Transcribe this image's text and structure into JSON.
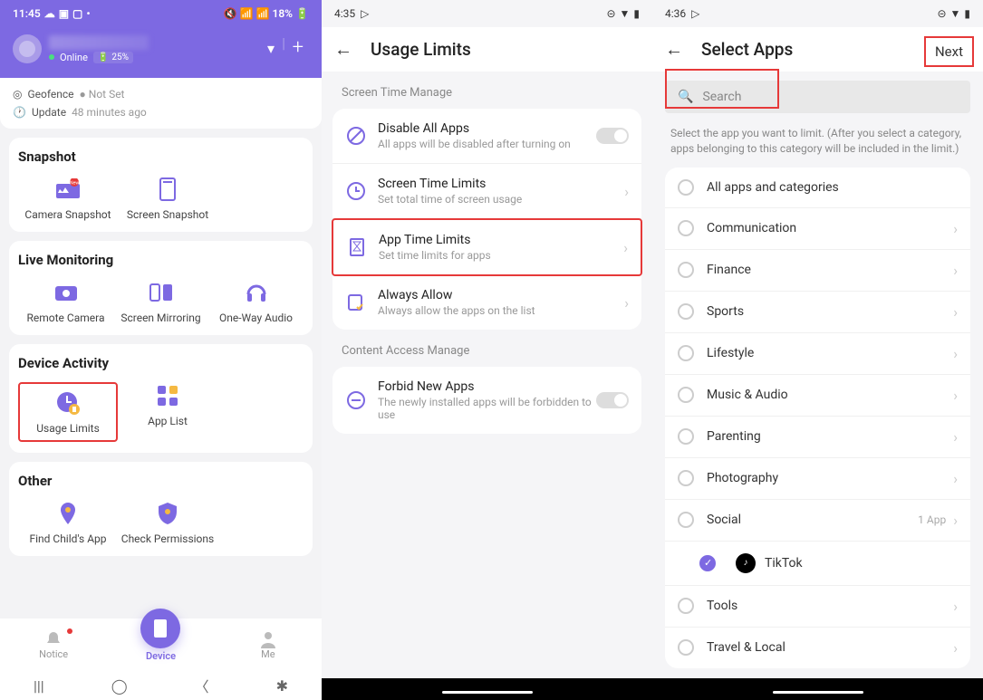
{
  "screen1": {
    "status": {
      "time": "11:45",
      "battery": "18%"
    },
    "profile": {
      "status": "Online",
      "battery": "25%"
    },
    "info": {
      "geofence_label": "Geofence",
      "geofence_value": "Not Set",
      "update_label": "Update",
      "update_value": "48 minutes ago"
    },
    "sections": {
      "snapshot": {
        "title": "Snapshot",
        "camera": "Camera Snapshot",
        "screen": "Screen Snapshot"
      },
      "live": {
        "title": "Live Monitoring",
        "camera": "Remote Camera",
        "mirror": "Screen Mirroring",
        "audio": "One-Way Audio"
      },
      "activity": {
        "title": "Device Activity",
        "usage": "Usage Limits",
        "applist": "App List"
      },
      "other": {
        "title": "Other",
        "find": "Find Child's App",
        "perm": "Check Permissions"
      }
    },
    "nav": {
      "notice": "Notice",
      "device": "Device",
      "me": "Me"
    }
  },
  "screen2": {
    "status": {
      "time": "4:35"
    },
    "title": "Usage Limits",
    "section1": "Screen Time Manage",
    "section2": "Content Access Manage",
    "rows": {
      "disable": {
        "title": "Disable All Apps",
        "sub": "All apps will be disabled after turning on"
      },
      "screentime": {
        "title": "Screen Time Limits",
        "sub": "Set total time of screen usage"
      },
      "apptime": {
        "title": "App Time Limits",
        "sub": "Set time limits for apps"
      },
      "always": {
        "title": "Always Allow",
        "sub": "Always allow the apps on the list"
      },
      "forbid": {
        "title": "Forbid New Apps",
        "sub": "The newly installed apps will be forbidden to use"
      }
    }
  },
  "screen3": {
    "status": {
      "time": "4:36"
    },
    "title": "Select Apps",
    "next": "Next",
    "search_placeholder": "Search",
    "hint": "Select the app you want to limit. (After you select a category, apps belonging to this category will be included in the limit.)",
    "categories": {
      "all": "All apps and categories",
      "comm": "Communication",
      "finance": "Finance",
      "sports": "Sports",
      "life": "Lifestyle",
      "music": "Music & Audio",
      "parent": "Parenting",
      "photo": "Photography",
      "social": "Social",
      "social_count": "1 App",
      "tiktok": "TikTok",
      "tools": "Tools",
      "travel": "Travel & Local"
    }
  }
}
